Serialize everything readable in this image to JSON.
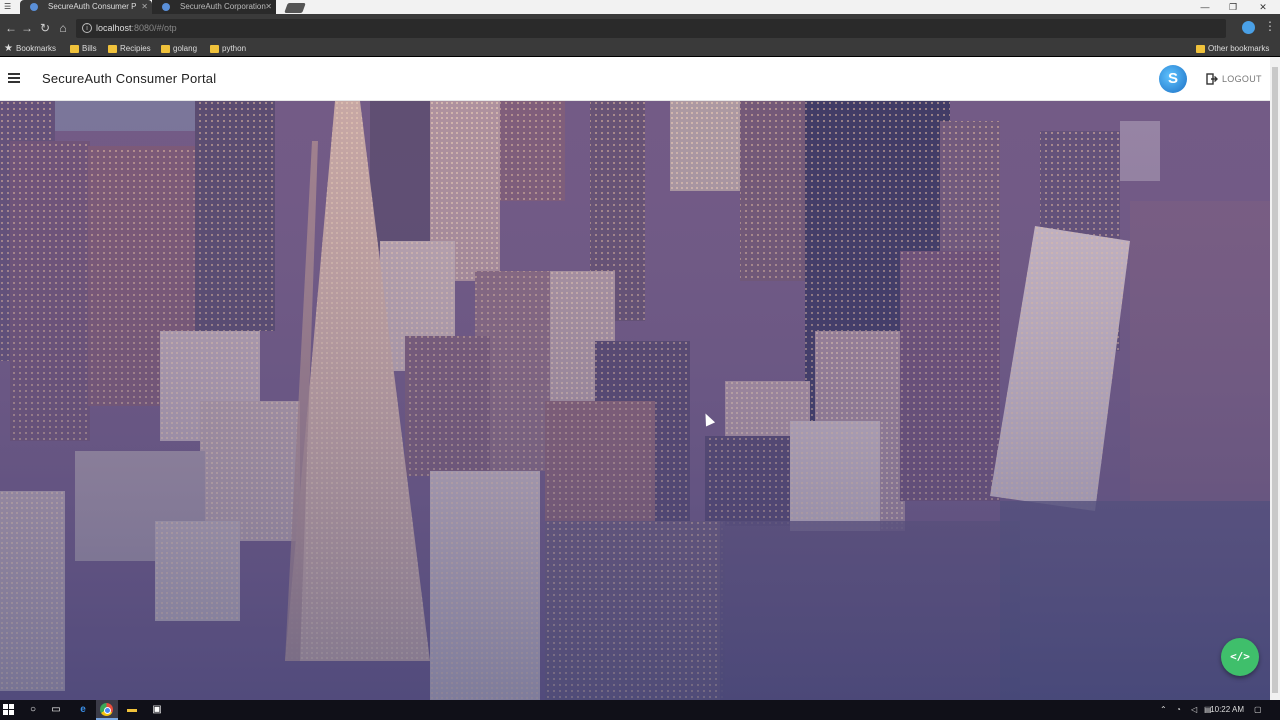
{
  "browser": {
    "tabs": [
      {
        "label": "SecureAuth Consumer P",
        "active": true
      },
      {
        "label": "SecureAuth Corporation",
        "active": false
      }
    ],
    "url_host": "localhost",
    "url_rest": ":8080/#/otp",
    "bookmarks": [
      "Bookmarks",
      "Bills",
      "Recipies",
      "golang",
      "python"
    ],
    "other_bookmarks": "Other bookmarks"
  },
  "app": {
    "title": "SecureAuth Consumer Portal",
    "logout_label": "LOGOUT",
    "fab_label": "</>"
  },
  "colors": {
    "fab": "#3fbf6b",
    "logo": "#1b6fc4"
  },
  "taskbar": {
    "time": "10:22 AM"
  }
}
